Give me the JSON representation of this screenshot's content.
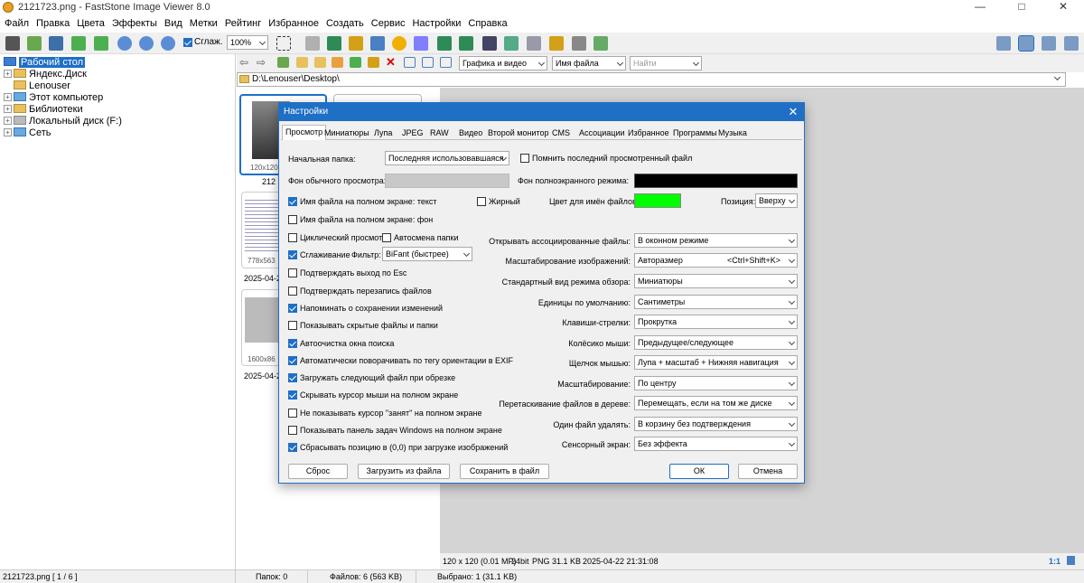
{
  "window": {
    "title": "2121723.png - FastStone Image Viewer 8.0",
    "title_short": "2121723.png",
    "app": "FastStone Image Viewer 8.0"
  },
  "menu": [
    "Файл",
    "Правка",
    "Цвета",
    "Эффекты",
    "Вид",
    "Метки",
    "Рейтинг",
    "Избранное",
    "Создать",
    "Сервис",
    "Настройки",
    "Справка"
  ],
  "toolbar": {
    "smooth_label": "Сглаж.",
    "zoom": "100%"
  },
  "nav": {
    "filter": "Графика и видео",
    "sort": "Имя файла",
    "search_placeholder": "Найти"
  },
  "path": "D:\\Lenouser\\Desktop\\",
  "tree": [
    {
      "label": "Рабочий стол",
      "selected": true
    },
    {
      "label": "Яндекс.Диск"
    },
    {
      "label": "Lenouser"
    },
    {
      "label": "Этот компьютер"
    },
    {
      "label": "Библиотеки"
    },
    {
      "label": "Локальный диск (F:)"
    },
    {
      "label": "Сеть"
    }
  ],
  "thumbs": [
    {
      "size": "120x120",
      "name": "212"
    },
    {
      "size": "778x563",
      "date": "2025-04-2"
    },
    {
      "size": "1600x86",
      "date": "2025-04-2"
    }
  ],
  "dialog": {
    "title": "Настройки",
    "tabs": [
      "Просмотр",
      "Миниатюры",
      "Лупа",
      "JPEG",
      "RAW",
      "Видео",
      "Второй монитор",
      "CMS",
      "Ассоциации",
      "Избранное",
      "Программы",
      "Музыка"
    ],
    "start_folder_label": "Начальная папка:",
    "start_folder_value": "Последняя использовавшаяся",
    "remember_last": "Помнить последний просмотренный файл",
    "bg_normal_label": "Фон обычного просмотра:",
    "bg_full_label": "Фон полноэкранного режима:",
    "filename_text": "Имя файла на полном экране: текст",
    "bold": "Жирный",
    "filename_color_label": "Цвет для имён файлов:",
    "position_label": "Позиция:",
    "position_value": "Вверху",
    "filename_bg": "Имя файла на полном экране: фон",
    "cyclic": "Циклический просмотр",
    "autosize_folder": "Автосмена папки",
    "smoothing": "Сглаживание",
    "filter_label": "Фильтр:",
    "filter_value": "BiFant (быстрее)",
    "confirm_exit": "Подтверждать выход по Esc",
    "confirm_overwrite": "Подтверждать перезапись файлов",
    "remind_save": "Напоминать о сохранении изменений",
    "show_hidden": "Показывать скрытые файлы и папки",
    "autoclear_search": "Автоочистка окна поиска",
    "auto_rotate": "Автоматически поворачивать по тегу ориентации в EXIF",
    "load_next_crop": "Загружать следующий файл при обрезке",
    "hide_cursor": "Скрывать курсор мыши на полном экране",
    "no_busy_cursor": "Не показывать курсор \"занят\" на полном экране",
    "show_taskbar": "Показывать панель задач Windows на полном экране",
    "reset_position": "Сбрасывать позицию в (0,0) при загрузке изображений",
    "right_settings": [
      {
        "label": "Открывать ассоциированные файлы:",
        "value": "В оконном режиме"
      },
      {
        "label": "Масштабирование изображений:",
        "value": "Авторазмер",
        "shortcut": "<Ctrl+Shift+K>"
      },
      {
        "label": "Стандартный вид режима обзора:",
        "value": "Миниатюры"
      },
      {
        "label": "Единицы по умолчанию:",
        "value": "Сантиметры"
      },
      {
        "label": "Клавиши-стрелки:",
        "value": "Прокрутка"
      },
      {
        "label": "Колёсико мыши:",
        "value": "Предыдущее/следующее"
      },
      {
        "label": "Щелчок мышью:",
        "value": "Лупа + масштаб + Нижняя навигация"
      },
      {
        "label": "Масштабирование:",
        "value": "По центру"
      },
      {
        "label": "Перетаскивание файлов в дереве:",
        "value": "Перемещать, если на том же диске"
      },
      {
        "label": "Один файл удалять:",
        "value": "В корзину без подтверждения"
      },
      {
        "label": "Сенсорный экран:",
        "value": "Без эффекта"
      }
    ],
    "buttons": {
      "reset": "Сброс",
      "load": "Загрузить из файла",
      "save": "Сохранить в файл",
      "ok": "ОК",
      "cancel": "Отмена"
    },
    "colors": {
      "bg_normal": "#c8c8c8",
      "bg_full": "#000000",
      "filename_color": "#00ff00"
    }
  },
  "image_info": {
    "dims": "120 x 120 (0.01 MP)",
    "depth": "24bit",
    "format": "PNG",
    "size": "31.1 KB",
    "date": "2025-04-22 21:31:08",
    "zoom": "1:1"
  },
  "status": {
    "file": "2121723.png [ 1 / 6 ]",
    "folders": "Папок: 0",
    "files": "Файлов: 6 (563 KB)",
    "selected": "Выбрано: 1 (31.1 KB)"
  },
  "accent": "#1f6fc5"
}
